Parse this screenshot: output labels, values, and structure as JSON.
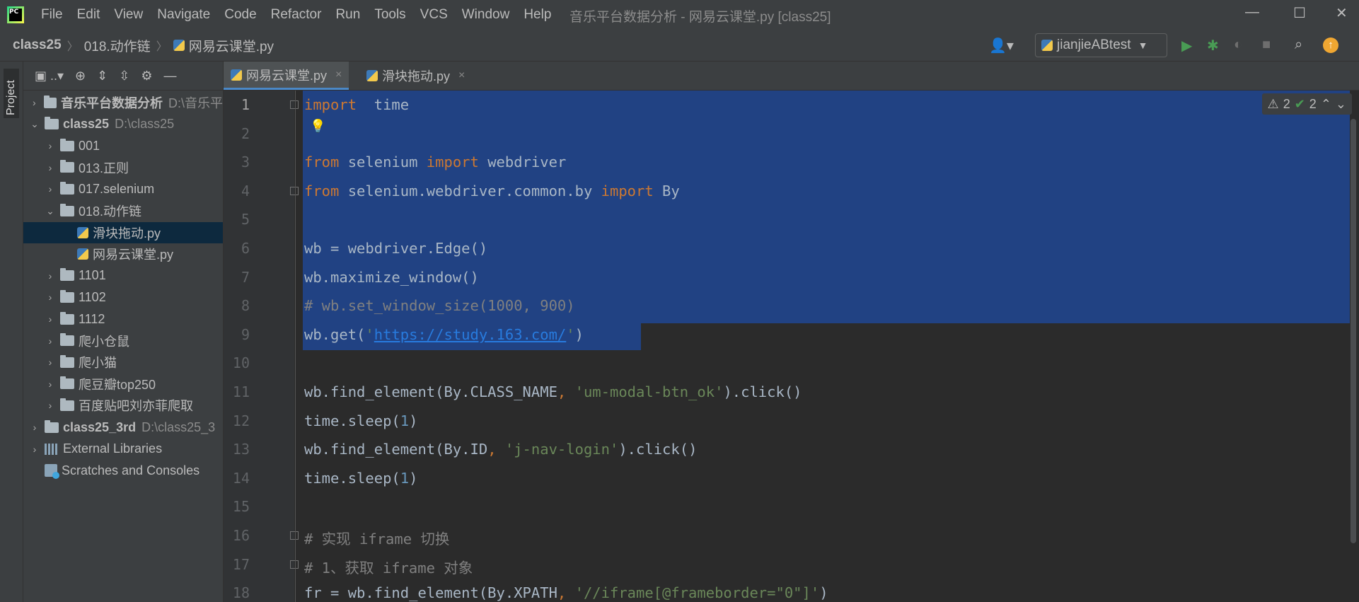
{
  "app": {
    "window_title": "音乐平台数据分析 - 网易云课堂.py [class25]",
    "logo_text": "PC",
    "menu": [
      "File",
      "Edit",
      "View",
      "Navigate",
      "Code",
      "Refactor",
      "Run",
      "Tools",
      "VCS",
      "Window",
      "Help"
    ],
    "window_controls": {
      "minimize": "—",
      "maximize": "☐",
      "close": "✕"
    }
  },
  "navbar": {
    "breadcrumb": [
      "class25",
      "018.动作链",
      "网易云课堂.py"
    ],
    "run_config": "jianjieABtest"
  },
  "side_tool": {
    "project_label": "Project"
  },
  "project_tree": [
    {
      "label": "音乐平台数据分析",
      "path": "D:\\音乐平",
      "level": 0,
      "expanded": false,
      "bold": true,
      "type": "folder"
    },
    {
      "label": "class25",
      "path": "D:\\class25",
      "level": 0,
      "expanded": true,
      "bold": true,
      "type": "folder"
    },
    {
      "label": "001",
      "path": "",
      "level": 1,
      "expanded": false,
      "bold": false,
      "type": "folder"
    },
    {
      "label": "013.正则",
      "path": "",
      "level": 1,
      "expanded": false,
      "bold": false,
      "type": "folder"
    },
    {
      "label": "017.selenium",
      "path": "",
      "level": 1,
      "expanded": false,
      "bold": false,
      "type": "folder"
    },
    {
      "label": "018.动作链",
      "path": "",
      "level": 1,
      "expanded": true,
      "bold": false,
      "type": "folder"
    },
    {
      "label": "滑块拖动.py",
      "path": "",
      "level": 2,
      "expanded": null,
      "bold": false,
      "type": "py",
      "selected": true
    },
    {
      "label": "网易云课堂.py",
      "path": "",
      "level": 2,
      "expanded": null,
      "bold": false,
      "type": "py"
    },
    {
      "label": "1101",
      "path": "",
      "level": 1,
      "expanded": false,
      "bold": false,
      "type": "folder"
    },
    {
      "label": "1102",
      "path": "",
      "level": 1,
      "expanded": false,
      "bold": false,
      "type": "folder"
    },
    {
      "label": "1112",
      "path": "",
      "level": 1,
      "expanded": false,
      "bold": false,
      "type": "folder"
    },
    {
      "label": "爬小仓鼠",
      "path": "",
      "level": 1,
      "expanded": false,
      "bold": false,
      "type": "folder"
    },
    {
      "label": "爬小猫",
      "path": "",
      "level": 1,
      "expanded": false,
      "bold": false,
      "type": "folder"
    },
    {
      "label": "爬豆瓣top250",
      "path": "",
      "level": 1,
      "expanded": false,
      "bold": false,
      "type": "folder"
    },
    {
      "label": "百度贴吧刘亦菲爬取",
      "path": "",
      "level": 1,
      "expanded": false,
      "bold": false,
      "type": "folder"
    },
    {
      "label": "class25_3rd",
      "path": "D:\\class25_3",
      "level": 0,
      "expanded": false,
      "bold": true,
      "type": "folder"
    },
    {
      "label": "External Libraries",
      "path": "",
      "level": 0,
      "expanded": false,
      "bold": false,
      "type": "lib"
    },
    {
      "label": "Scratches and Consoles",
      "path": "",
      "level": 0,
      "expanded": null,
      "bold": false,
      "type": "scratch"
    }
  ],
  "tabs": [
    {
      "label": "网易云课堂.py",
      "active": true
    },
    {
      "label": "滑块拖动.py",
      "active": false
    }
  ],
  "inspections": {
    "warnings": "2",
    "weak_warnings": "2"
  },
  "code_lines": [
    [
      [
        "kw",
        "import"
      ],
      [
        "",
        "  time"
      ]
    ],
    [],
    [
      [
        "kw",
        "from"
      ],
      [
        "",
        " selenium "
      ],
      [
        "kw",
        "import"
      ],
      [
        "",
        " webdriver"
      ]
    ],
    [
      [
        "kw",
        "from"
      ],
      [
        "",
        " selenium.webdriver.common.by "
      ],
      [
        "kw",
        "import"
      ],
      [
        "",
        " By"
      ]
    ],
    [],
    [
      [
        "",
        "wb = webdriver.Edge()"
      ]
    ],
    [
      [
        "",
        "wb.maximize_window()"
      ]
    ],
    [
      [
        "cmt",
        "# wb.set_window_size(1000, 900)"
      ]
    ],
    [
      [
        "",
        "wb.get("
      ],
      [
        "str",
        "'"
      ],
      [
        "url",
        "https://study.163.com/"
      ],
      [
        "str",
        "'"
      ],
      [
        "",
        ")"
      ]
    ],
    [],
    [
      [
        "",
        "wb.find_element(By.CLASS_NAME"
      ],
      [
        "kw",
        ","
      ],
      [
        "str",
        " 'um-modal-btn_ok'"
      ],
      [
        "",
        ").click()"
      ]
    ],
    [
      [
        "",
        "time.sleep("
      ],
      [
        "num",
        "1"
      ],
      [
        "",
        ")"
      ]
    ],
    [
      [
        "",
        "wb.find_element(By.ID"
      ],
      [
        "kw",
        ","
      ],
      [
        "str",
        " 'j-nav-login'"
      ],
      [
        "",
        ").click()"
      ]
    ],
    [
      [
        "",
        "time.sleep("
      ],
      [
        "num",
        "1"
      ],
      [
        "",
        ")"
      ]
    ],
    [],
    [
      [
        "cmt",
        "# 实现 iframe 切换"
      ]
    ],
    [
      [
        "cmt",
        "# 1、获取 iframe 对象"
      ]
    ],
    [
      [
        "",
        "fr = wb.find_element(By.XPATH"
      ],
      [
        "kw",
        ","
      ],
      [
        "str",
        " '//iframe[@frameborder=\"0\"]'"
      ],
      [
        "",
        ")"
      ]
    ]
  ]
}
